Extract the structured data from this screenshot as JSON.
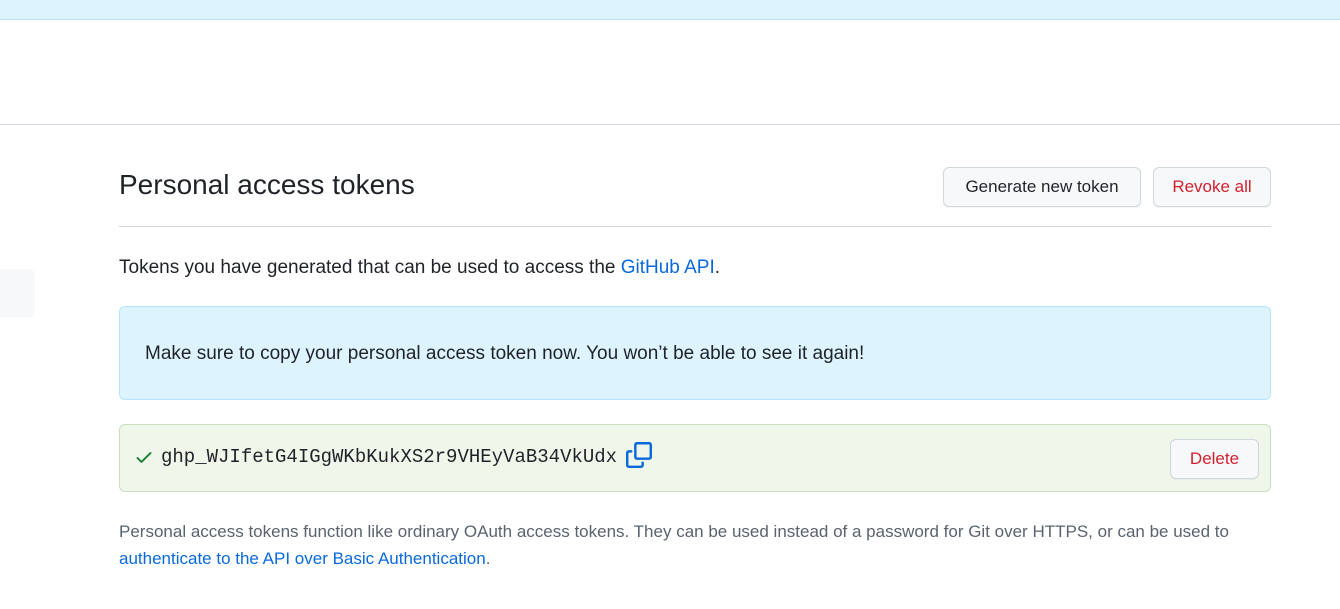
{
  "page": {
    "title": "Personal access tokens"
  },
  "toolbar": {
    "generate_label": "Generate new token",
    "revoke_label": "Revoke all"
  },
  "intro": {
    "text_before": "Tokens you have generated that can be used to access the ",
    "link_label": "GitHub API",
    "text_after": "."
  },
  "flash": {
    "message": "Make sure to copy your personal access token now. You won’t be able to see it again!"
  },
  "token": {
    "value": "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",
    "delete_label": "Delete",
    "status_icon": "check-icon",
    "copy_icon": "copy-icon"
  },
  "footer": {
    "text": "Personal access tokens function like ordinary OAuth access tokens. They can be used instead of a password for Git over HTTPS, or can be used to ",
    "link_label": "authenticate to the API over Basic Authentication",
    "text_after": "."
  },
  "colors": {
    "accent": "#0969da",
    "danger": "#cf222e",
    "info_bg": "#ddf4ff",
    "success_bg": "#eff7ea",
    "success_icon": "#1a7f37"
  }
}
